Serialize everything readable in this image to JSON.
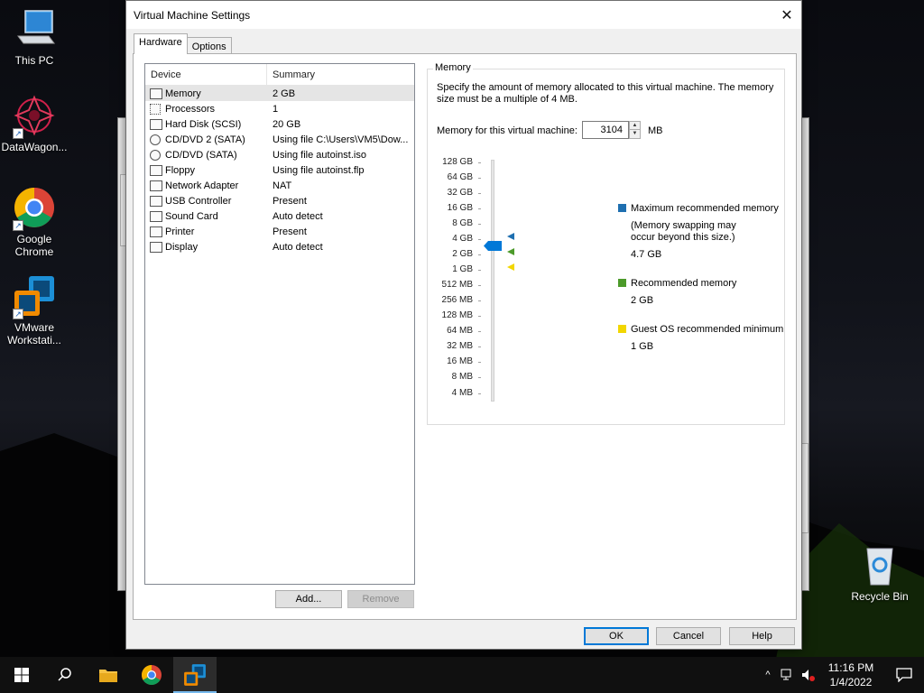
{
  "desktop": {
    "icons": [
      {
        "name": "this-pc",
        "label": "This PC"
      },
      {
        "name": "datawagon",
        "label": "DataWagon..."
      },
      {
        "name": "google-chrome",
        "label": "Google Chrome"
      },
      {
        "name": "vmware",
        "label": "VMware Workstati..."
      },
      {
        "name": "recycle-bin",
        "label": "Recycle Bin"
      }
    ]
  },
  "dialog": {
    "title": "Virtual Machine Settings",
    "close_icon": "close-icon",
    "tabs": [
      {
        "label": "Hardware",
        "active": true
      },
      {
        "label": "Options",
        "active": false
      }
    ],
    "device_list": {
      "headers": {
        "device": "Device",
        "summary": "Summary"
      },
      "rows": [
        {
          "device": "Memory",
          "summary": "2 GB",
          "icon": "memory-icon",
          "selected": true
        },
        {
          "device": "Processors",
          "summary": "1",
          "icon": "processor-icon"
        },
        {
          "device": "Hard Disk (SCSI)",
          "summary": "20 GB",
          "icon": "hard-disk-icon"
        },
        {
          "device": "CD/DVD 2 (SATA)",
          "summary": "Using file C:\\Users\\VM5\\Dow...",
          "icon": "cd-dvd-icon"
        },
        {
          "device": "CD/DVD (SATA)",
          "summary": "Using file autoinst.iso",
          "icon": "cd-dvd-icon"
        },
        {
          "device": "Floppy",
          "summary": "Using file autoinst.flp",
          "icon": "floppy-icon"
        },
        {
          "device": "Network Adapter",
          "summary": "NAT",
          "icon": "network-adapter-icon"
        },
        {
          "device": "USB Controller",
          "summary": "Present",
          "icon": "usb-icon"
        },
        {
          "device": "Sound Card",
          "summary": "Auto detect",
          "icon": "sound-card-icon"
        },
        {
          "device": "Printer",
          "summary": "Present",
          "icon": "printer-icon"
        },
        {
          "device": "Display",
          "summary": "Auto detect",
          "icon": "display-icon"
        }
      ]
    },
    "buttons": {
      "add": "Add...",
      "remove": "Remove",
      "ok": "OK",
      "cancel": "Cancel",
      "help": "Help"
    },
    "memory": {
      "group_title": "Memory",
      "description": "Specify the amount of memory allocated to this virtual machine. The memory size must be a multiple of 4 MB.",
      "field_label": "Memory for this virtual machine:",
      "value": "3104",
      "unit": "MB",
      "scale_labels": [
        "128 GB",
        "64 GB",
        "32 GB",
        "16 GB",
        "8 GB",
        "4 GB",
        "2 GB",
        "1 GB",
        "512 MB",
        "256 MB",
        "128 MB",
        "64 MB",
        "32 MB",
        "16 MB",
        "8 MB",
        "4 MB"
      ],
      "legend": {
        "max": {
          "label": "Maximum recommended memory",
          "note": "(Memory swapping may occur beyond this size.)",
          "value": "4.7 GB",
          "color": "#1e6fb0"
        },
        "recommended": {
          "label": "Recommended memory",
          "value": "2 GB",
          "color": "#4c9a2a"
        },
        "guest_min": {
          "label": "Guest OS recommended minimum",
          "value": "1 GB",
          "color": "#f2d600"
        }
      }
    }
  },
  "taskbar": {
    "time": "11:16 PM",
    "date": "1/4/2022"
  }
}
